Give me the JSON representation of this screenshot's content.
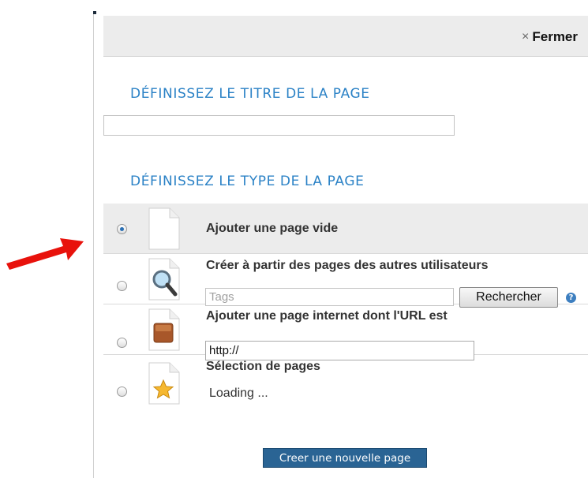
{
  "header": {
    "close_label": "Fermer",
    "close_icon": "×"
  },
  "sections": {
    "title_heading": "DÉFINISSEZ LE TITRE DE LA PAGE",
    "title_value": "",
    "type_heading": "DÉFINISSEZ LE TYPE DE LA PAGE"
  },
  "options": [
    {
      "label": "Ajouter une page vide",
      "selected": true,
      "icon": "blank-page-icon"
    },
    {
      "label": "Créer à partir des pages des autres utilisateurs",
      "selected": false,
      "icon": "magnifier-page-icon",
      "tags_placeholder": "Tags",
      "search_label": "Rechercher",
      "help_icon": "?"
    },
    {
      "label": "Ajouter une page internet dont l'URL est",
      "selected": false,
      "icon": "www-page-icon",
      "url_value": "http://"
    },
    {
      "label": "Sélection de pages",
      "selected": false,
      "icon": "star-page-icon",
      "status": "Loading ..."
    }
  ],
  "footer": {
    "create_label": "Creer une nouvelle page"
  },
  "colors": {
    "heading": "#2b82c6",
    "primary_button": "#2a6494",
    "annotation_arrow": "#e8120c"
  }
}
